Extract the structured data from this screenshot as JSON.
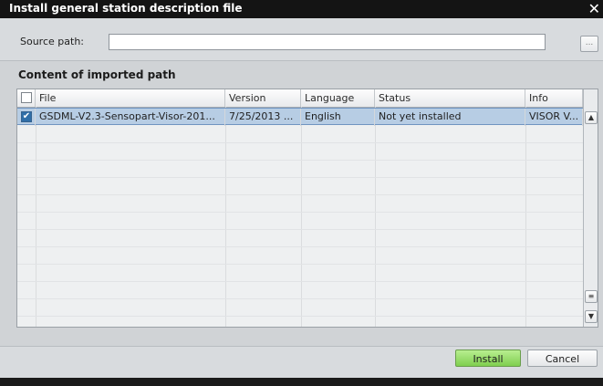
{
  "window": {
    "title": "Install general station description file",
    "close_glyph": "✕"
  },
  "source": {
    "label": "Source path:",
    "value": "",
    "placeholder": "",
    "browse_label": "..."
  },
  "content": {
    "title": "Content of imported path"
  },
  "table": {
    "columns": [
      "File",
      "Version",
      "Language",
      "Status",
      "Info"
    ],
    "rows": [
      {
        "checked": true,
        "file": "GSDML-V2.3-Sensopart-Visor-201...",
        "version": "7/25/2013 ...",
        "language": "English",
        "status": "Not yet installed",
        "info": "VISOR V..."
      }
    ]
  },
  "buttons": {
    "install": "Install",
    "cancel": "Cancel"
  },
  "colors": {
    "install_green": "#8fdc5d",
    "selection_blue": "#b7cde4"
  }
}
